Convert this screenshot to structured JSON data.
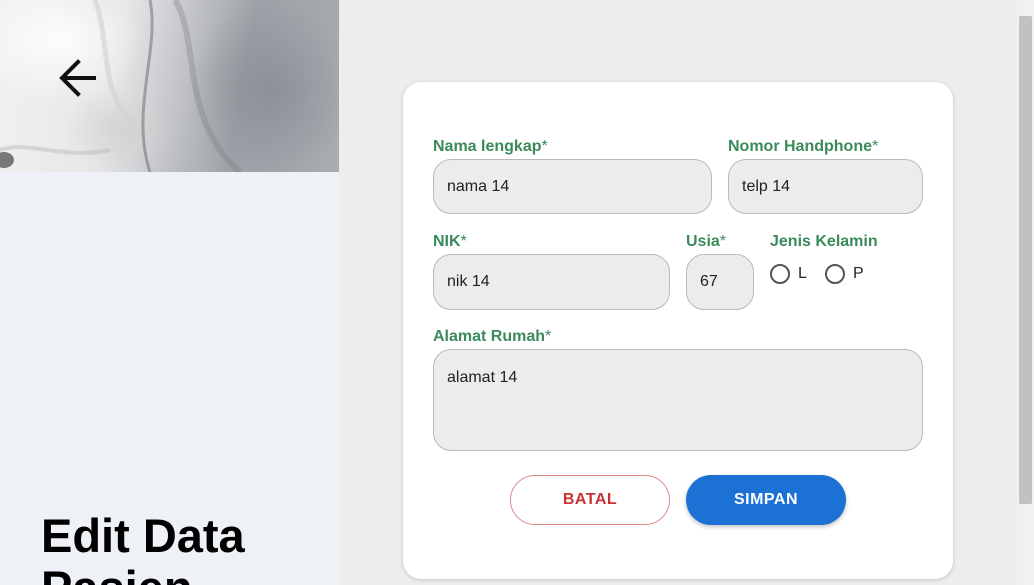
{
  "page": {
    "title": "Edit Data Pasien"
  },
  "form": {
    "nama": {
      "label": "Nama lengkap",
      "required": "*",
      "value": "nama 14"
    },
    "telepon": {
      "label": "Nomor Handphone",
      "required": "*",
      "value": "telp 14"
    },
    "nik": {
      "label": "NIK",
      "required": "*",
      "value": "nik 14"
    },
    "usia": {
      "label": "Usia",
      "required": "*",
      "value": "67"
    },
    "jenis_kelamin": {
      "label": "Jenis Kelamin",
      "options": [
        "L",
        "P"
      ],
      "selected": null
    },
    "alamat": {
      "label": "Alamat Rumah",
      "required": "*",
      "value": "alamat 14"
    }
  },
  "actions": {
    "cancel_label": "BATAL",
    "save_label": "SIMPAN"
  },
  "icons": {
    "back": "arrow-left-icon"
  },
  "colors": {
    "label_green": "#3a8a5c",
    "save_blue": "#1c72d4",
    "cancel_red": "#c83232"
  }
}
